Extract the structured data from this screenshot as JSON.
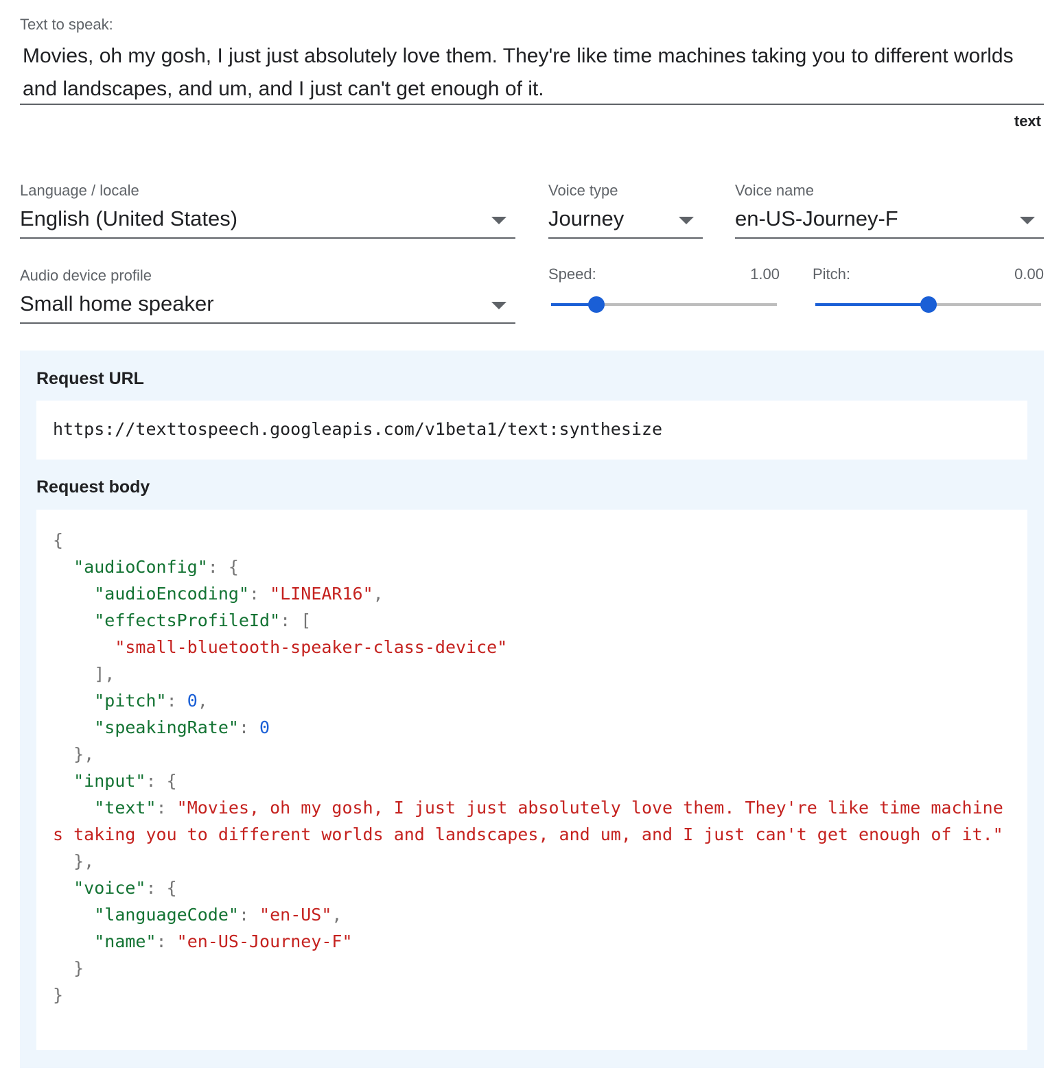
{
  "text_input": {
    "label": "Text to speak:",
    "value": "Movies, oh my gosh, I just just absolutely love them. They're like time machines taking you to different worlds and landscapes, and um, and I just can't get enough of it.",
    "mode": "text"
  },
  "language": {
    "label": "Language / locale",
    "value": "English (United States)",
    "icon": "dropdown-arrow-icon"
  },
  "voice_type": {
    "label": "Voice type",
    "value": "Journey",
    "icon": "dropdown-arrow-icon"
  },
  "voice_name": {
    "label": "Voice name",
    "value": "en-US-Journey-F",
    "icon": "dropdown-arrow-icon"
  },
  "audio_profile": {
    "label": "Audio device profile",
    "value": "Small home speaker",
    "icon": "dropdown-arrow-icon"
  },
  "speed": {
    "label": "Speed:",
    "value": "1.00",
    "level": 0.2
  },
  "pitch": {
    "label": "Pitch:",
    "value": "0.00",
    "level": 0.5
  },
  "request": {
    "url_heading": "Request URL",
    "url": "https://texttospeech.googleapis.com/v1beta1/text:synthesize",
    "body_heading": "Request body",
    "body": {
      "k_audioConfig": "\"audioConfig\"",
      "k_audioEncoding": "\"audioEncoding\"",
      "v_audioEncoding": "\"LINEAR16\"",
      "k_effectsProfileId": "\"effectsProfileId\"",
      "v_effect": "\"small-bluetooth-speaker-class-device\"",
      "k_pitch": "\"pitch\"",
      "v_pitch": "0",
      "k_speakingRate": "\"speakingRate\"",
      "v_speakingRate": "0",
      "k_input": "\"input\"",
      "k_text": "\"text\"",
      "v_text": "\"Movies, oh my gosh, I just just absolutely love them. They're like time machines taking you to different worlds and landscapes, and um, and I just can't get enough of it.\"",
      "k_voice": "\"voice\"",
      "k_languageCode": "\"languageCode\"",
      "v_languageCode": "\"en-US\"",
      "k_name": "\"name\"",
      "v_name": "\"en-US-Journey-F\""
    }
  },
  "colors": {
    "accent": "#1a5fd6",
    "panel_background": "#eef6fd",
    "json_key": "#137333",
    "json_string": "#c5221f",
    "json_number": "#1a5fd6"
  }
}
